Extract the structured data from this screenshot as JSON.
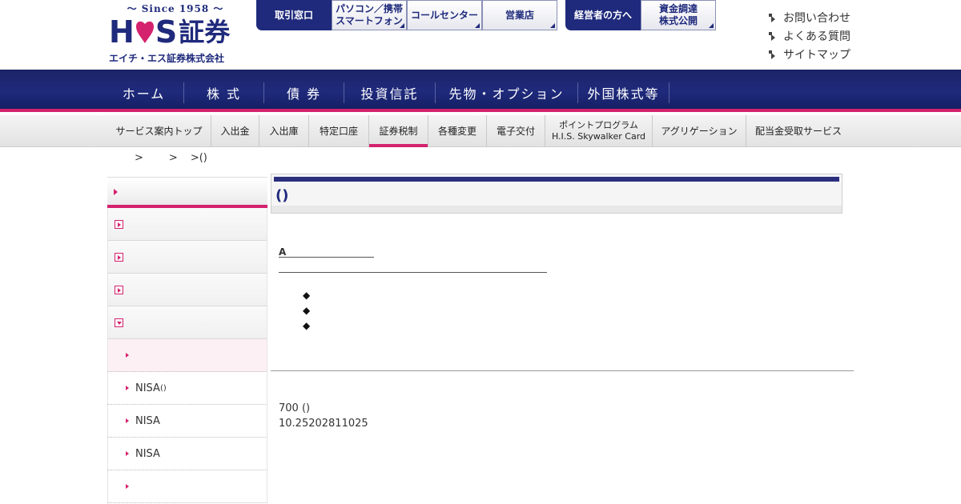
{
  "logo": {
    "since": "〜 Since 1958 〜",
    "letter_h": "H",
    "letter_s": "S",
    "kanji": "証券",
    "company": "エイチ・エス証券株式会社"
  },
  "top_tabs_group1": [
    {
      "line1": "取引窓口",
      "line2": ""
    },
    {
      "line1": "パソコン／携帯",
      "line2": "スマートフォン"
    },
    {
      "line1": "コールセンター",
      "line2": ""
    },
    {
      "line1": "営業店",
      "line2": ""
    }
  ],
  "top_tabs_group2": [
    {
      "line1": "経営者の方へ",
      "line2": ""
    },
    {
      "line1": "資金調達",
      "line2": "株式公開"
    }
  ],
  "util_links": [
    "お問い合わせ",
    "よくある質問",
    "サイトマップ"
  ],
  "global_nav": [
    "ホーム",
    "株 式",
    "債 券",
    "投資信託",
    "先物・オプション",
    "外国株式等"
  ],
  "sub_nav": [
    {
      "line1": "サービス案内トップ",
      "line2": ""
    },
    {
      "line1": "入出金",
      "line2": ""
    },
    {
      "line1": "入出庫",
      "line2": ""
    },
    {
      "line1": "特定口座",
      "line2": ""
    },
    {
      "line1": "証券税制",
      "line2": ""
    },
    {
      "line1": "各種変更",
      "line2": ""
    },
    {
      "line1": "電子交付",
      "line2": ""
    },
    {
      "line1": "ポイントプログラム",
      "line2": "H.I.S. Skywalker Card"
    },
    {
      "line1": "アグリゲーション",
      "line2": ""
    },
    {
      "line1": "配当金受取サービス",
      "line2": ""
    }
  ],
  "breadcrumb": {
    "sep1": ">",
    "sep2": ">",
    "last": ">()"
  },
  "sidebar": {
    "sub_items": [
      {
        "label": "",
        "small": ""
      },
      {
        "label": "NISA",
        "small": "()"
      },
      {
        "label": "NISA",
        "small": ""
      },
      {
        "label": "NISA",
        "small": ""
      },
      {
        "label": "",
        "small": ""
      }
    ]
  },
  "main": {
    "title": "()",
    "section_a": "A",
    "diamond": "◆",
    "body_line1": "700 ()",
    "body_line2": "10.25202811025"
  }
}
